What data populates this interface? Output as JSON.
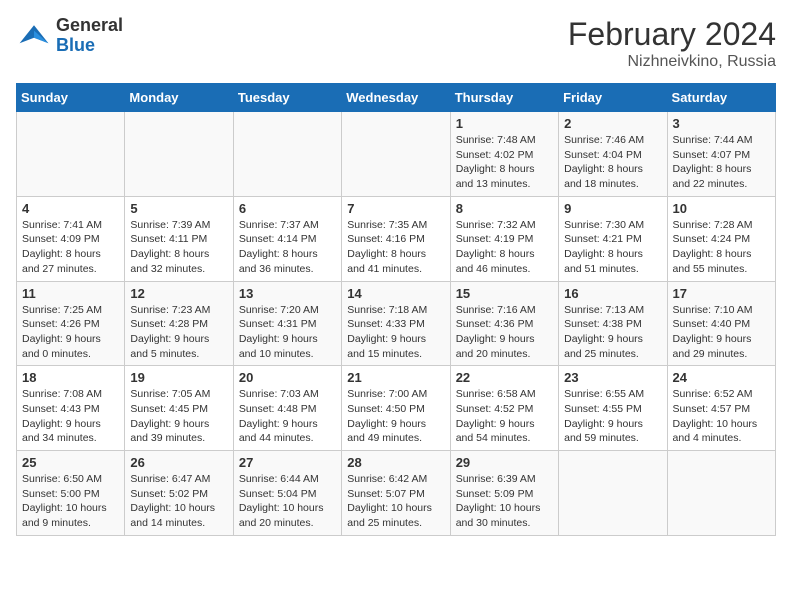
{
  "logo": {
    "general": "General",
    "blue": "Blue"
  },
  "title": "February 2024",
  "location": "Nizhneivkino, Russia",
  "days_of_week": [
    "Sunday",
    "Monday",
    "Tuesday",
    "Wednesday",
    "Thursday",
    "Friday",
    "Saturday"
  ],
  "weeks": [
    [
      {
        "day": "",
        "info": ""
      },
      {
        "day": "",
        "info": ""
      },
      {
        "day": "",
        "info": ""
      },
      {
        "day": "",
        "info": ""
      },
      {
        "day": "1",
        "info": "Sunrise: 7:48 AM\nSunset: 4:02 PM\nDaylight: 8 hours\nand 13 minutes."
      },
      {
        "day": "2",
        "info": "Sunrise: 7:46 AM\nSunset: 4:04 PM\nDaylight: 8 hours\nand 18 minutes."
      },
      {
        "day": "3",
        "info": "Sunrise: 7:44 AM\nSunset: 4:07 PM\nDaylight: 8 hours\nand 22 minutes."
      }
    ],
    [
      {
        "day": "4",
        "info": "Sunrise: 7:41 AM\nSunset: 4:09 PM\nDaylight: 8 hours\nand 27 minutes."
      },
      {
        "day": "5",
        "info": "Sunrise: 7:39 AM\nSunset: 4:11 PM\nDaylight: 8 hours\nand 32 minutes."
      },
      {
        "day": "6",
        "info": "Sunrise: 7:37 AM\nSunset: 4:14 PM\nDaylight: 8 hours\nand 36 minutes."
      },
      {
        "day": "7",
        "info": "Sunrise: 7:35 AM\nSunset: 4:16 PM\nDaylight: 8 hours\nand 41 minutes."
      },
      {
        "day": "8",
        "info": "Sunrise: 7:32 AM\nSunset: 4:19 PM\nDaylight: 8 hours\nand 46 minutes."
      },
      {
        "day": "9",
        "info": "Sunrise: 7:30 AM\nSunset: 4:21 PM\nDaylight: 8 hours\nand 51 minutes."
      },
      {
        "day": "10",
        "info": "Sunrise: 7:28 AM\nSunset: 4:24 PM\nDaylight: 8 hours\nand 55 minutes."
      }
    ],
    [
      {
        "day": "11",
        "info": "Sunrise: 7:25 AM\nSunset: 4:26 PM\nDaylight: 9 hours\nand 0 minutes."
      },
      {
        "day": "12",
        "info": "Sunrise: 7:23 AM\nSunset: 4:28 PM\nDaylight: 9 hours\nand 5 minutes."
      },
      {
        "day": "13",
        "info": "Sunrise: 7:20 AM\nSunset: 4:31 PM\nDaylight: 9 hours\nand 10 minutes."
      },
      {
        "day": "14",
        "info": "Sunrise: 7:18 AM\nSunset: 4:33 PM\nDaylight: 9 hours\nand 15 minutes."
      },
      {
        "day": "15",
        "info": "Sunrise: 7:16 AM\nSunset: 4:36 PM\nDaylight: 9 hours\nand 20 minutes."
      },
      {
        "day": "16",
        "info": "Sunrise: 7:13 AM\nSunset: 4:38 PM\nDaylight: 9 hours\nand 25 minutes."
      },
      {
        "day": "17",
        "info": "Sunrise: 7:10 AM\nSunset: 4:40 PM\nDaylight: 9 hours\nand 29 minutes."
      }
    ],
    [
      {
        "day": "18",
        "info": "Sunrise: 7:08 AM\nSunset: 4:43 PM\nDaylight: 9 hours\nand 34 minutes."
      },
      {
        "day": "19",
        "info": "Sunrise: 7:05 AM\nSunset: 4:45 PM\nDaylight: 9 hours\nand 39 minutes."
      },
      {
        "day": "20",
        "info": "Sunrise: 7:03 AM\nSunset: 4:48 PM\nDaylight: 9 hours\nand 44 minutes."
      },
      {
        "day": "21",
        "info": "Sunrise: 7:00 AM\nSunset: 4:50 PM\nDaylight: 9 hours\nand 49 minutes."
      },
      {
        "day": "22",
        "info": "Sunrise: 6:58 AM\nSunset: 4:52 PM\nDaylight: 9 hours\nand 54 minutes."
      },
      {
        "day": "23",
        "info": "Sunrise: 6:55 AM\nSunset: 4:55 PM\nDaylight: 9 hours\nand 59 minutes."
      },
      {
        "day": "24",
        "info": "Sunrise: 6:52 AM\nSunset: 4:57 PM\nDaylight: 10 hours\nand 4 minutes."
      }
    ],
    [
      {
        "day": "25",
        "info": "Sunrise: 6:50 AM\nSunset: 5:00 PM\nDaylight: 10 hours\nand 9 minutes."
      },
      {
        "day": "26",
        "info": "Sunrise: 6:47 AM\nSunset: 5:02 PM\nDaylight: 10 hours\nand 14 minutes."
      },
      {
        "day": "27",
        "info": "Sunrise: 6:44 AM\nSunset: 5:04 PM\nDaylight: 10 hours\nand 20 minutes."
      },
      {
        "day": "28",
        "info": "Sunrise: 6:42 AM\nSunset: 5:07 PM\nDaylight: 10 hours\nand 25 minutes."
      },
      {
        "day": "29",
        "info": "Sunrise: 6:39 AM\nSunset: 5:09 PM\nDaylight: 10 hours\nand 30 minutes."
      },
      {
        "day": "",
        "info": ""
      },
      {
        "day": "",
        "info": ""
      }
    ]
  ]
}
